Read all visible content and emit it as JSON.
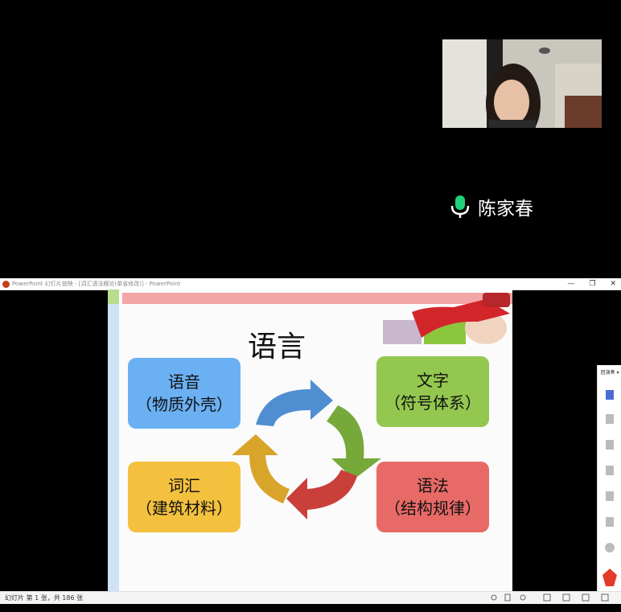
{
  "meeting": {
    "speaker_name": "陈家春"
  },
  "ppt_window": {
    "title": "PowerPoint 幻灯片放映 - [词汇语法概论(单省修改)] - PowerPoint",
    "minimize_glyph": "—",
    "restore_glyph": "❐",
    "close_glyph": "✕",
    "status_text": "幻灯片 第 1 张，共 186 张",
    "side_panel_label": "团演奏 ▾"
  },
  "slide": {
    "title": "语言",
    "boxes": [
      {
        "line1": "语音",
        "line2": "（物质外壳）",
        "color": "#6ab0f3"
      },
      {
        "line1": "文字",
        "line2": "（符号体系）",
        "color": "#93c74f"
      },
      {
        "line1": "词汇",
        "line2": "（建筑材料）",
        "color": "#f4c13f"
      },
      {
        "line1": "语法",
        "line2": "（结构规律）",
        "color": "#e76a67"
      }
    ]
  },
  "colors": {
    "arrow_blue": "#4f8fd1",
    "arrow_green": "#76a83a",
    "arrow_red": "#c9403a",
    "arrow_yellow": "#d9a42a"
  }
}
